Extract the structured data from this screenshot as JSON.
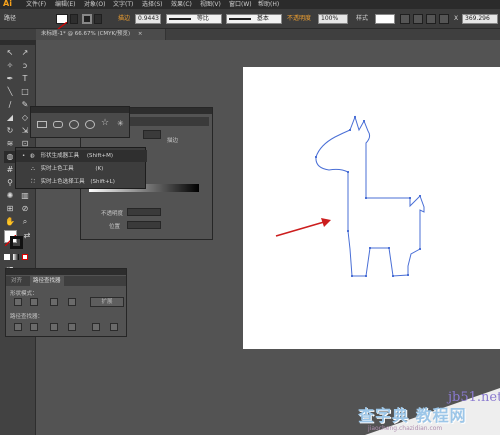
{
  "menubar": {
    "logo": "Ai",
    "items": [
      "文件(F)",
      "编辑(E)",
      "对象(O)",
      "文字(T)",
      "选择(S)",
      "效果(C)",
      "视图(V)",
      "窗口(W)",
      "帮助(H)"
    ]
  },
  "control_bar": {
    "path_label": "路径",
    "stroke_label": "描边",
    "stroke_value": "0.9443",
    "uniform_label": "等比",
    "basic_label": "基本",
    "opacity_label": "不透明度",
    "opacity_value": "100%",
    "style_label": "样式",
    "right_value": "369.296"
  },
  "document_tab": {
    "title": "未标题-1* @ 66.67% (CMYK/预览)",
    "close": "×"
  },
  "tool_popup": {
    "items": [
      {
        "label": "形状生成器工具",
        "shortcut": "(Shift+M)"
      },
      {
        "label": "实时上色工具",
        "shortcut": "(K)"
      },
      {
        "label": "实时上色选择工具",
        "shortcut": "(Shift+L)"
      }
    ]
  },
  "gradient_panel": {
    "stroke_label": "描边",
    "opacity_label": "不透明度",
    "position_label": "位置"
  },
  "pathfinder_panel": {
    "tabs": [
      "对齐",
      "路径查找器"
    ],
    "shape_modes_label": "形状模式：",
    "expand_label": "扩展",
    "pathfinders_label": "路径查找器："
  },
  "watermark": {
    "url": "jb51.net",
    "text": "查字典 教程网",
    "sub": "jiaocheng.chazidian.com"
  },
  "colors": {
    "annotation_arrow": "#cc1d1d",
    "path_stroke": "#4a6fd6",
    "logo": "#f7a21b"
  }
}
